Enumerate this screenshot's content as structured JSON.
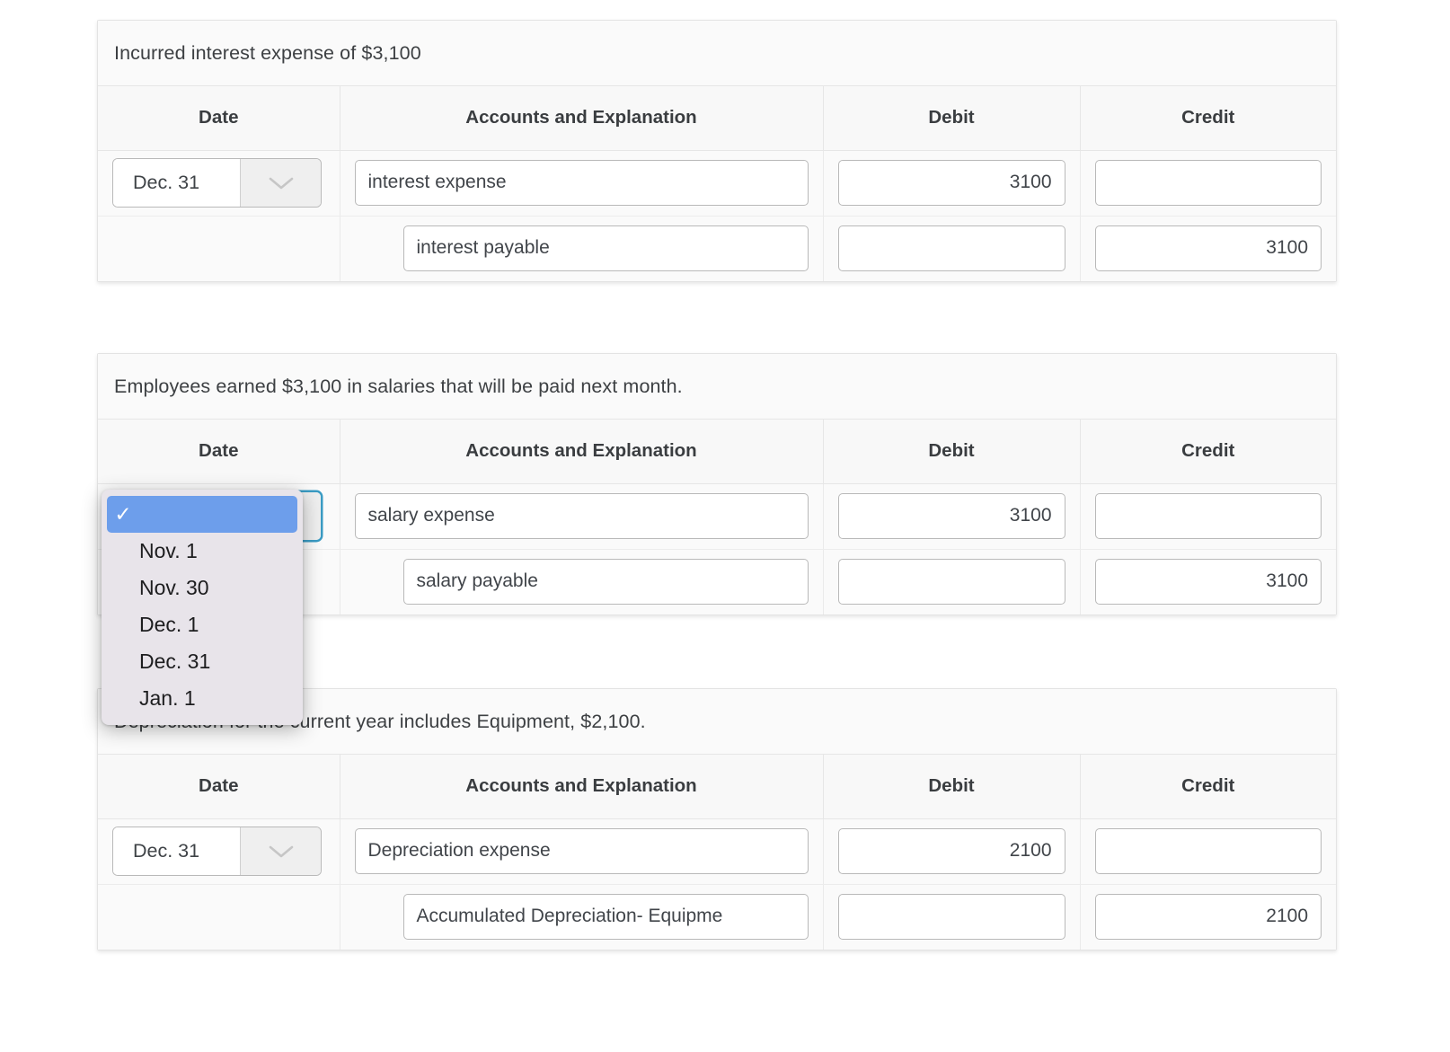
{
  "columns": [
    "Date",
    "Accounts and Explanation",
    "Debit",
    "Credit"
  ],
  "icons": {
    "chevron": "chevron-down-icon",
    "check": "check-icon"
  },
  "colors": {
    "highlight": "#6d9eeb",
    "popup_bg": "#e8e4ea",
    "focus_ring": "#3b9cc4"
  },
  "entries": [
    {
      "prompt": "Incurred interest expense of $3,100",
      "rows": [
        {
          "date": "Dec. 31",
          "account": "interest expense",
          "debit": "3100",
          "credit": ""
        },
        {
          "date": "",
          "account": "interest payable",
          "debit": "",
          "credit": "3100"
        }
      ]
    },
    {
      "prompt": "Employees earned $3,100 in salaries that will be paid next month.",
      "rows": [
        {
          "date": "",
          "account": "salary expense",
          "debit": "3100",
          "credit": ""
        },
        {
          "date": "",
          "account": "salary payable",
          "debit": "",
          "credit": "3100"
        }
      ]
    },
    {
      "prompt": "Depreciation for the current year includes Equipment, $2,100.",
      "rows": [
        {
          "date": "Dec. 31",
          "account": "Depreciation expense",
          "debit": "2100",
          "credit": ""
        },
        {
          "date": "",
          "account": "Accumulated Depreciation- Equipme",
          "debit": "",
          "credit": "2100"
        }
      ]
    }
  ],
  "dropdown": {
    "selected_label": "",
    "options": [
      "",
      "Nov. 1",
      "Nov. 30",
      "Dec. 1",
      "Dec. 31",
      "Jan. 1"
    ]
  }
}
